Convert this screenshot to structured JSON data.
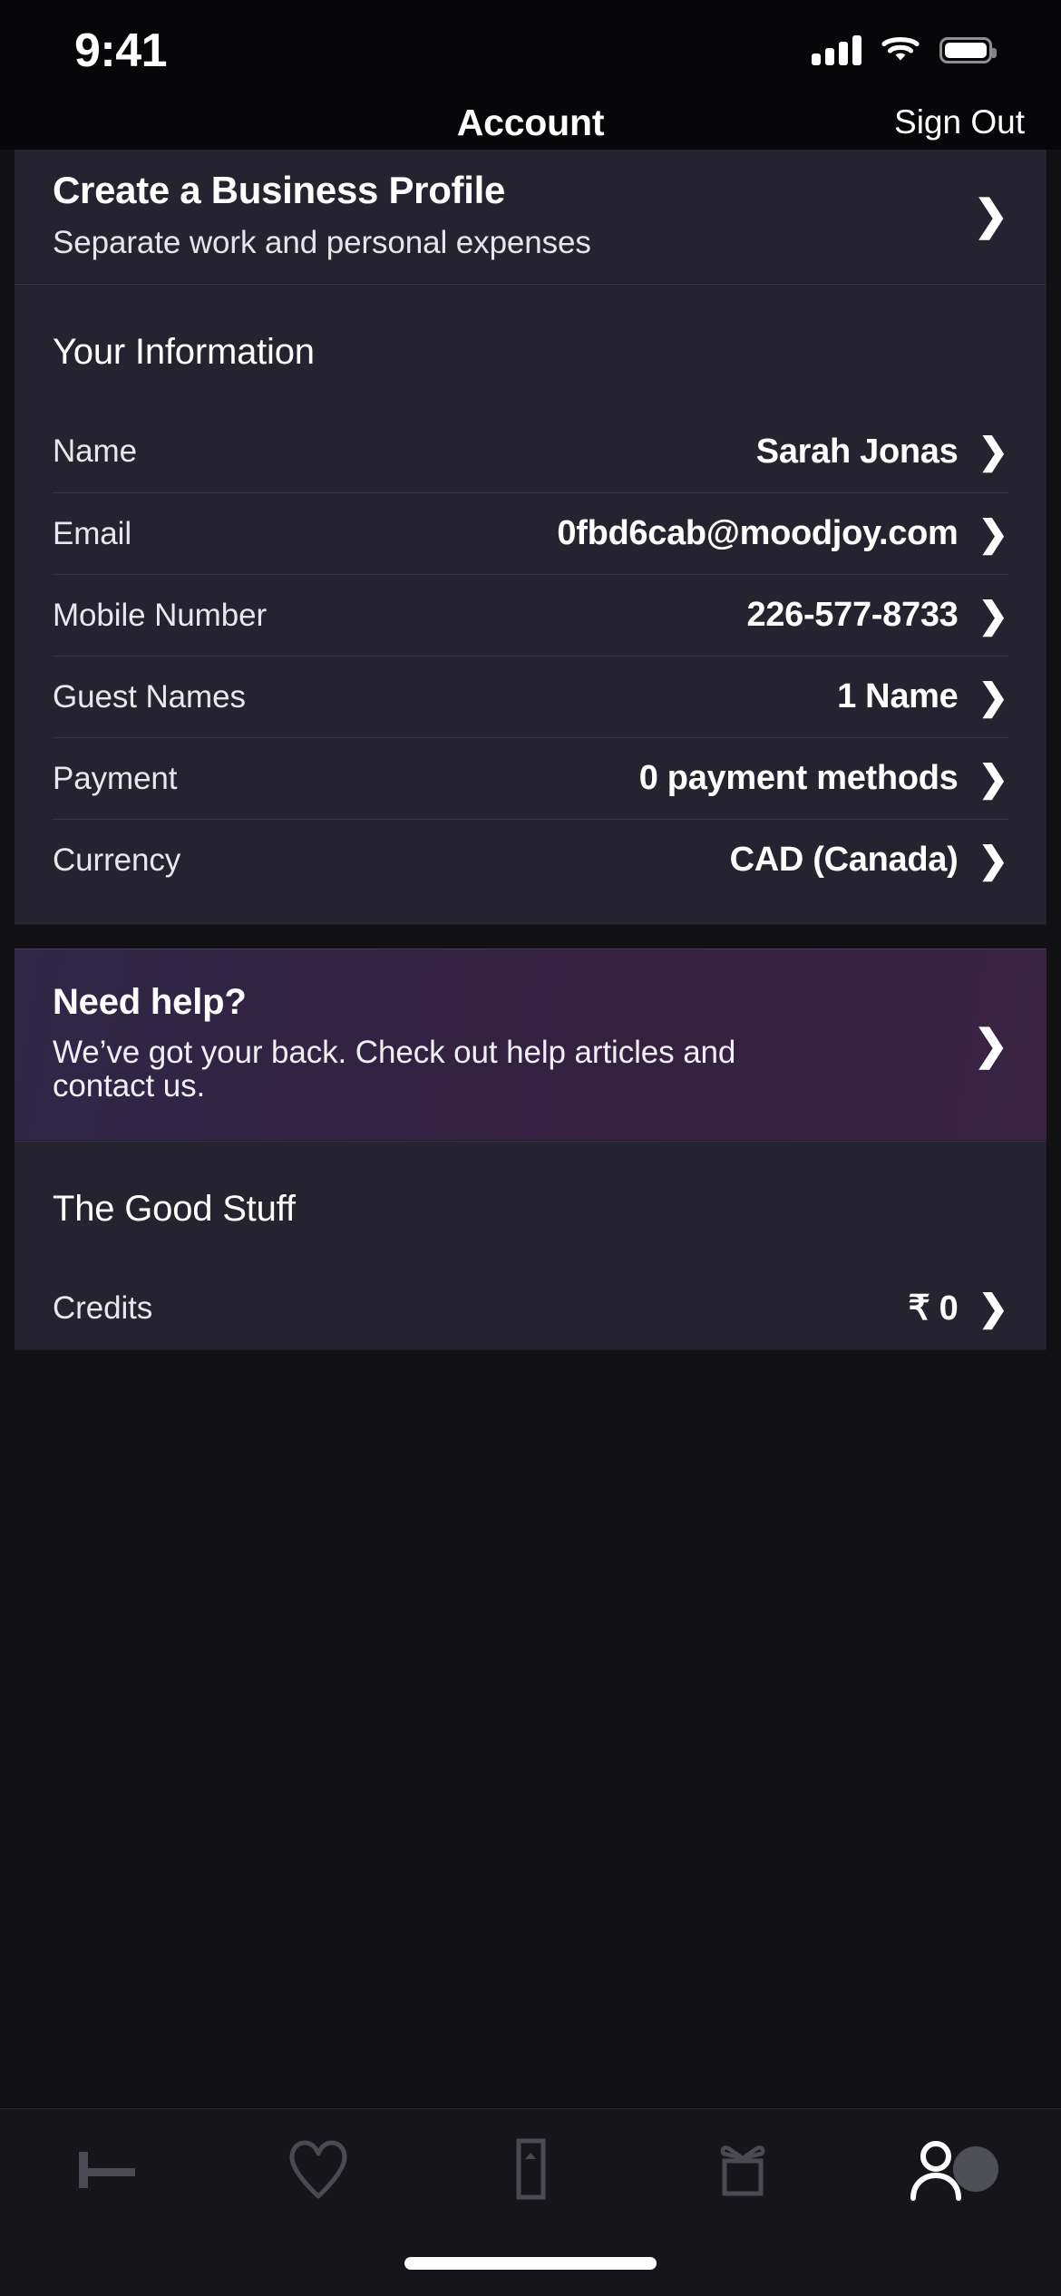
{
  "status_bar": {
    "time": "9:41",
    "cellular_icon": "signal-bars-icon",
    "wifi_icon": "wifi-icon",
    "battery_icon": "battery-icon"
  },
  "nav": {
    "title": "Account",
    "sign_out_label": "Sign Out"
  },
  "business_profile": {
    "title": "Create a Business Profile",
    "subtitle": "Separate work and personal expenses",
    "chevron": "❯"
  },
  "your_information": {
    "section_title": "Your Information",
    "rows": [
      {
        "label": "Name",
        "value": "Sarah Jonas",
        "chevron": "❯"
      },
      {
        "label": "Email",
        "value": "0fbd6cab@moodjoy.com",
        "chevron": "❯"
      },
      {
        "label": "Mobile Number",
        "value": "226-577-8733",
        "chevron": "❯"
      },
      {
        "label": "Guest Names",
        "value": "1 Name",
        "chevron": "❯"
      },
      {
        "label": "Payment",
        "value": "0 payment methods",
        "chevron": "❯"
      },
      {
        "label": "Currency",
        "value": "CAD (Canada)",
        "chevron": "❯"
      }
    ]
  },
  "help": {
    "title": "Need help?",
    "subtitle": "We’ve got your back. Check out help articles and contact us.",
    "chevron": "❯",
    "accent_color": "#34203f"
  },
  "good_stuff": {
    "section_title": "The Good Stuff",
    "rows": [
      {
        "label": "Credits",
        "value": "₹ 0",
        "chevron": "❯"
      }
    ]
  },
  "tab_bar": {
    "items": [
      {
        "name": "stays",
        "icon": "bed-icon",
        "active": false
      },
      {
        "name": "favorites",
        "icon": "heart-icon",
        "active": false
      },
      {
        "name": "trips",
        "icon": "ticket-icon",
        "active": false
      },
      {
        "name": "rewards",
        "icon": "gift-icon",
        "active": false
      },
      {
        "name": "account",
        "icon": "person-icon",
        "active": true
      }
    ],
    "inactive_color": "#4a4a52",
    "active_color": "#ffffff"
  },
  "home_indicator": {
    "label": "home-indicator"
  },
  "theme": {
    "page_background": "#111114",
    "card_background": "#25232f",
    "status_background": "#07070a",
    "divider": "#363442"
  }
}
